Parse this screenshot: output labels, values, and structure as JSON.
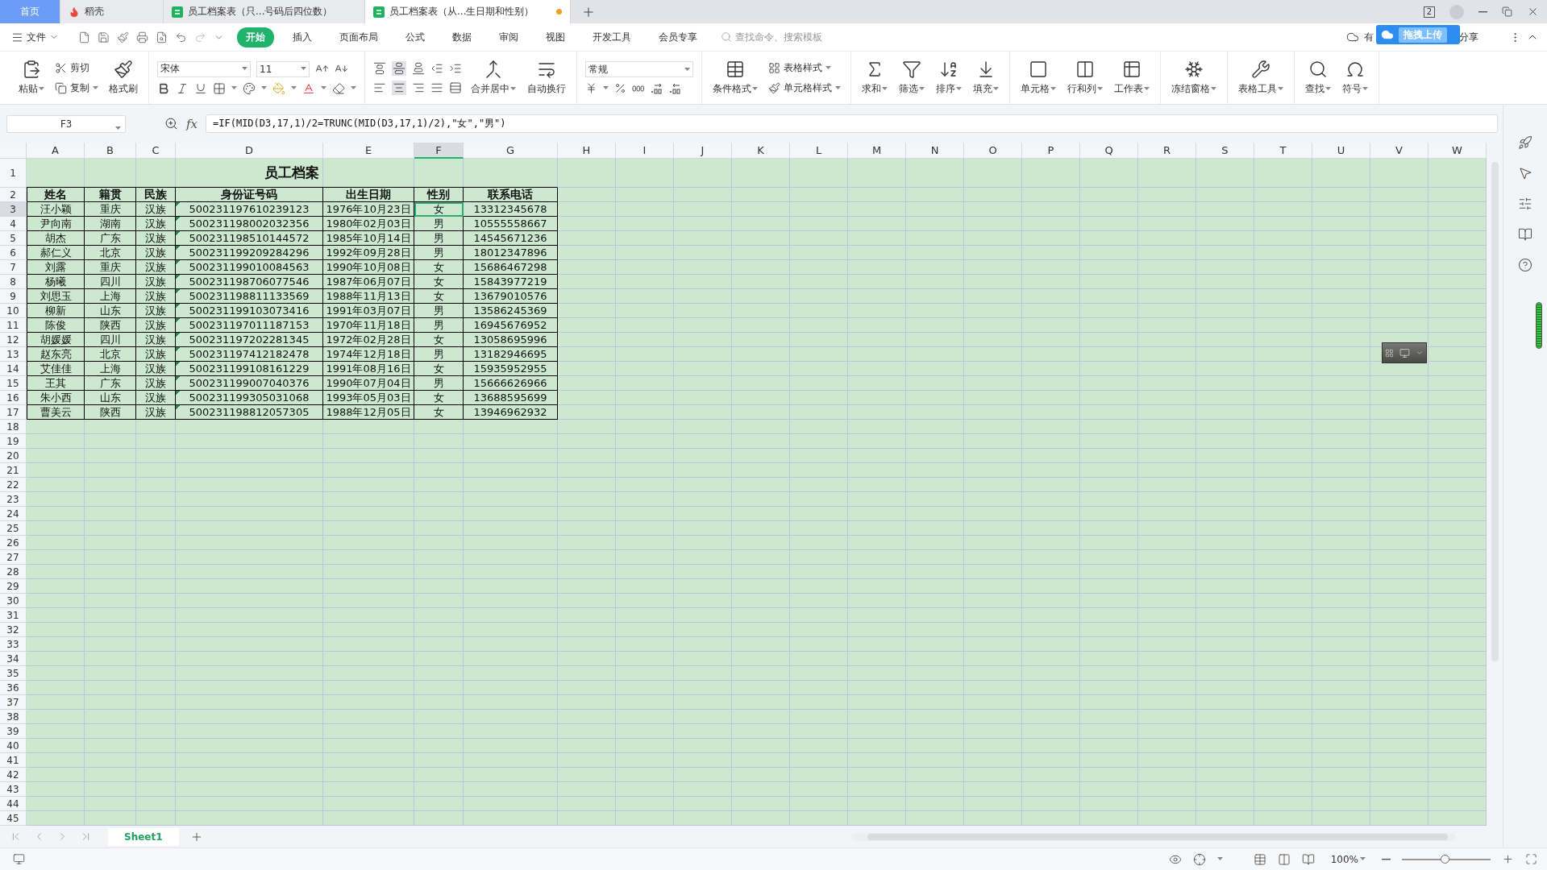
{
  "tabs": [
    {
      "kind": "home",
      "label": "首页",
      "selected": false,
      "unsaved": false
    },
    {
      "kind": "docer",
      "label": "稻壳",
      "selected": false,
      "unsaved": false
    },
    {
      "kind": "sheet",
      "label": "员工档案表（只...号码后四位数）",
      "selected": false,
      "unsaved": false
    },
    {
      "kind": "sheet",
      "label": "员工档案表（从...生日期和性别）",
      "selected": true,
      "unsaved": true
    }
  ],
  "window_count": "2",
  "file_menu": "文件",
  "ribbon_tabs": [
    {
      "label": "开始",
      "selected": true
    },
    {
      "label": "插入",
      "selected": false
    },
    {
      "label": "页面布局",
      "selected": false
    },
    {
      "label": "公式",
      "selected": false
    },
    {
      "label": "数据",
      "selected": false
    },
    {
      "label": "审阅",
      "selected": false
    },
    {
      "label": "视图",
      "selected": false
    },
    {
      "label": "开发工具",
      "selected": false
    },
    {
      "label": "会员专享",
      "selected": false
    }
  ],
  "search_placeholder": "查找命令、搜索模板",
  "sync_status": "有",
  "upload_popup": "拖拽上传",
  "share": "分享",
  "clipboard": {
    "paste": "粘贴",
    "cut": "剪切",
    "copy": "复制",
    "format_painter": "格式刷"
  },
  "font": {
    "name": "宋体",
    "size": "11"
  },
  "alignment": {
    "merge": "合并居中",
    "wrap": "自动换行"
  },
  "number_format": "常规",
  "styles": {
    "conditional": "条件格式",
    "table_style": "表格样式",
    "cell_style": "单元格样式"
  },
  "tools": [
    "求和",
    "筛选",
    "排序",
    "填充",
    "单元格",
    "行和列",
    "工作表",
    "冻结窗格",
    "表格工具",
    "查找",
    "符号"
  ],
  "name_box": "F3",
  "fx": "fx",
  "formula": "=IF(MID(D3,17,1)/2=TRUNC(MID(D3,17,1)/2),\"女\",\"男\")",
  "columns": [
    {
      "label": "A",
      "selected": false
    },
    {
      "label": "B",
      "selected": false
    },
    {
      "label": "C",
      "selected": false
    },
    {
      "label": "D",
      "selected": false
    },
    {
      "label": "E",
      "selected": false
    },
    {
      "label": "F",
      "selected": true
    },
    {
      "label": "G",
      "selected": false
    },
    {
      "label": "H",
      "selected": false
    },
    {
      "label": "I",
      "selected": false
    },
    {
      "label": "J",
      "selected": false
    },
    {
      "label": "K",
      "selected": false
    },
    {
      "label": "L",
      "selected": false
    },
    {
      "label": "M",
      "selected": false
    },
    {
      "label": "N",
      "selected": false
    },
    {
      "label": "O",
      "selected": false
    },
    {
      "label": "P",
      "selected": false
    },
    {
      "label": "Q",
      "selected": false
    },
    {
      "label": "R",
      "selected": false
    },
    {
      "label": "S",
      "selected": false
    },
    {
      "label": "T",
      "selected": false
    },
    {
      "label": "U",
      "selected": false
    },
    {
      "label": "V",
      "selected": false
    },
    {
      "label": "W",
      "selected": false
    }
  ],
  "row_headers": [
    {
      "label": "1",
      "selected": false
    },
    {
      "label": "2",
      "selected": false
    },
    {
      "label": "3",
      "selected": true
    },
    {
      "label": "4",
      "selected": false
    },
    {
      "label": "5",
      "selected": false
    },
    {
      "label": "6",
      "selected": false
    },
    {
      "label": "7",
      "selected": false
    },
    {
      "label": "8",
      "selected": false
    },
    {
      "label": "9",
      "selected": false
    },
    {
      "label": "10",
      "selected": false
    },
    {
      "label": "11",
      "selected": false
    },
    {
      "label": "12",
      "selected": false
    },
    {
      "label": "13",
      "selected": false
    },
    {
      "label": "14",
      "selected": false
    },
    {
      "label": "15",
      "selected": false
    },
    {
      "label": "16",
      "selected": false
    },
    {
      "label": "17",
      "selected": false
    },
    {
      "label": "18",
      "selected": false
    },
    {
      "label": "19",
      "selected": false
    },
    {
      "label": "20",
      "selected": false
    },
    {
      "label": "21",
      "selected": false
    },
    {
      "label": "22",
      "selected": false
    },
    {
      "label": "23",
      "selected": false
    },
    {
      "label": "24",
      "selected": false
    },
    {
      "label": "25",
      "selected": false
    },
    {
      "label": "26",
      "selected": false
    },
    {
      "label": "27",
      "selected": false
    },
    {
      "label": "28",
      "selected": false
    },
    {
      "label": "29",
      "selected": false
    },
    {
      "label": "30",
      "selected": false
    },
    {
      "label": "31",
      "selected": false
    },
    {
      "label": "32",
      "selected": false
    },
    {
      "label": "33",
      "selected": false
    },
    {
      "label": "34",
      "selected": false
    },
    {
      "label": "35",
      "selected": false
    },
    {
      "label": "36",
      "selected": false
    },
    {
      "label": "37",
      "selected": false
    },
    {
      "label": "38",
      "selected": false
    },
    {
      "label": "39",
      "selected": false
    },
    {
      "label": "40",
      "selected": false
    },
    {
      "label": "41",
      "selected": false
    },
    {
      "label": "42",
      "selected": false
    },
    {
      "label": "43",
      "selected": false
    },
    {
      "label": "44",
      "selected": false
    },
    {
      "label": "45",
      "selected": false
    }
  ],
  "sheet": {
    "title": "员工档案",
    "headers": [
      "姓名",
      "籍贯",
      "民族",
      "身份证号码",
      "出生日期",
      "性别",
      "联系电话"
    ],
    "rows": [
      [
        "汪小颖",
        "重庆",
        "汉族",
        "500231197610239123",
        "1976年10月23日",
        "女",
        "13312345678"
      ],
      [
        "尹向南",
        "湖南",
        "汉族",
        "500231198002032356",
        "1980年02月03日",
        "男",
        "10555558667"
      ],
      [
        "胡杰",
        "广东",
        "汉族",
        "500231198510144572",
        "1985年10月14日",
        "男",
        "14545671236"
      ],
      [
        "郝仁义",
        "北京",
        "汉族",
        "500231199209284296",
        "1992年09月28日",
        "男",
        "18012347896"
      ],
      [
        "刘露",
        "重庆",
        "汉族",
        "500231199010084563",
        "1990年10月08日",
        "女",
        "15686467298"
      ],
      [
        "杨曦",
        "四川",
        "汉族",
        "500231198706077546",
        "1987年06月07日",
        "女",
        "15843977219"
      ],
      [
        "刘思玉",
        "上海",
        "汉族",
        "500231198811133569",
        "1988年11月13日",
        "女",
        "13679010576"
      ],
      [
        "柳新",
        "山东",
        "汉族",
        "500231199103073416",
        "1991年03月07日",
        "男",
        "13586245369"
      ],
      [
        "陈俊",
        "陕西",
        "汉族",
        "500231197011187153",
        "1970年11月18日",
        "男",
        "16945676952"
      ],
      [
        "胡媛媛",
        "四川",
        "汉族",
        "500231197202281345",
        "1972年02月28日",
        "女",
        "13058695996"
      ],
      [
        "赵东亮",
        "北京",
        "汉族",
        "500231197412182478",
        "1974年12月18日",
        "男",
        "13182946695"
      ],
      [
        "艾佳佳",
        "上海",
        "汉族",
        "500231199108161229",
        "1991年08月16日",
        "女",
        "15935952955"
      ],
      [
        "王其",
        "广东",
        "汉族",
        "500231199007040376",
        "1990年07月04日",
        "男",
        "15666626966"
      ],
      [
        "朱小西",
        "山东",
        "汉族",
        "500231199305031068",
        "1993年05月03日",
        "女",
        "13688595699"
      ],
      [
        "曹美云",
        "陕西",
        "汉族",
        "500231198812057305",
        "1988年12月05日",
        "女",
        "13946962932"
      ]
    ]
  },
  "sheet_tabs": [
    {
      "label": "Sheet1",
      "selected": true
    }
  ],
  "zoom": {
    "label": "100%",
    "level": 0.48
  }
}
